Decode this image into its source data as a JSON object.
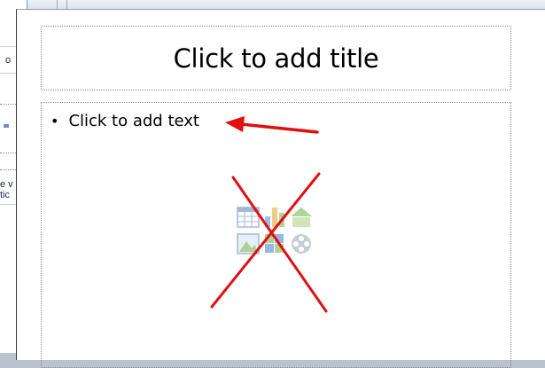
{
  "slide": {
    "title_placeholder": "Click to add title",
    "content_placeholder": "Click to add text",
    "bullet": "•"
  },
  "content_icons": [
    "insert-table-icon",
    "insert-chart-icon",
    "insert-smartart-icon",
    "insert-picture-icon",
    "insert-clipart-icon",
    "insert-media-icon"
  ],
  "annotations": {
    "arrow_color": "#e01010",
    "cross_color": "#e01010"
  },
  "background_window": {
    "fragments": [
      "o",
      "e v",
      "tic"
    ]
  }
}
